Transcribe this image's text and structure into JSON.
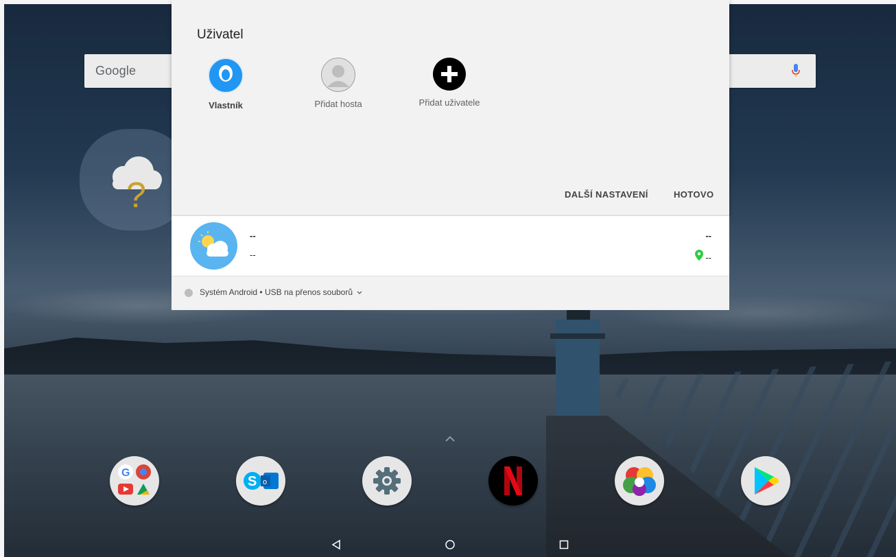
{
  "search": {
    "logo": "Google",
    "mic_icon": "mic-icon"
  },
  "quick_settings": {
    "title": "Uživatel",
    "users": [
      {
        "label": "Vlastník",
        "icon": "user-avatar-icon"
      },
      {
        "label": "Přidat hosta",
        "icon": "guest-avatar-icon"
      },
      {
        "label": "Přidat uživatele",
        "icon": "add-user-icon"
      }
    ],
    "more_settings_label": "DALŠÍ NASTAVENÍ",
    "done_label": "HOTOVO"
  },
  "weather_notification": {
    "line1": "--",
    "line2": "--",
    "right_top": "--",
    "right_bottom": "--"
  },
  "system_notification": {
    "app": "Systém Android",
    "separator": "•",
    "text": "USB na přenos souborů"
  },
  "dock": [
    {
      "name": "google-apps-folder"
    },
    {
      "name": "skype-outlook-folder"
    },
    {
      "name": "settings-app"
    },
    {
      "name": "netflix-app"
    },
    {
      "name": "gallery-app"
    },
    {
      "name": "play-store-app"
    }
  ],
  "colors": {
    "accent_blue": "#2196f3",
    "weather_blue": "#5ab4f0",
    "location_green": "#2ecc40"
  }
}
